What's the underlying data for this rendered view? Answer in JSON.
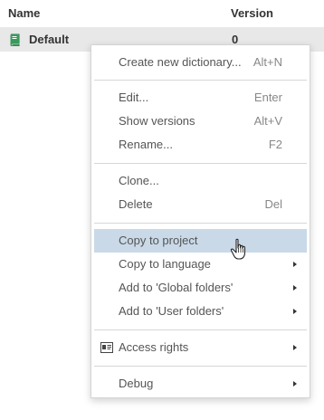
{
  "table": {
    "columns": [
      "Name",
      "Version"
    ],
    "rows": [
      {
        "name": "Default",
        "version": "0",
        "icon": "dictionary-book-icon"
      }
    ]
  },
  "context_menu": {
    "items": [
      {
        "label": "Create new dictionary...",
        "shortcut": "Alt+N"
      },
      {
        "label": "Edit...",
        "shortcut": "Enter"
      },
      {
        "label": "Show versions",
        "shortcut": "Alt+V"
      },
      {
        "label": "Rename...",
        "shortcut": "F2"
      },
      {
        "label": "Clone...",
        "shortcut": ""
      },
      {
        "label": "Delete",
        "shortcut": "Del"
      },
      {
        "label": "Copy to project",
        "shortcut": "",
        "highlighted": true
      },
      {
        "label": "Copy to language",
        "submenu": true
      },
      {
        "label": "Add to 'Global folders'",
        "submenu": true
      },
      {
        "label": "Add to 'User folders'",
        "submenu": true
      },
      {
        "label": "Access rights",
        "submenu": true,
        "icon": "id-card-icon"
      },
      {
        "label": "Debug",
        "submenu": true
      }
    ]
  },
  "colors": {
    "highlight": "#c9d9e8",
    "row_selected": "#e8e8e8",
    "book_icon": "#3a9a5b"
  }
}
